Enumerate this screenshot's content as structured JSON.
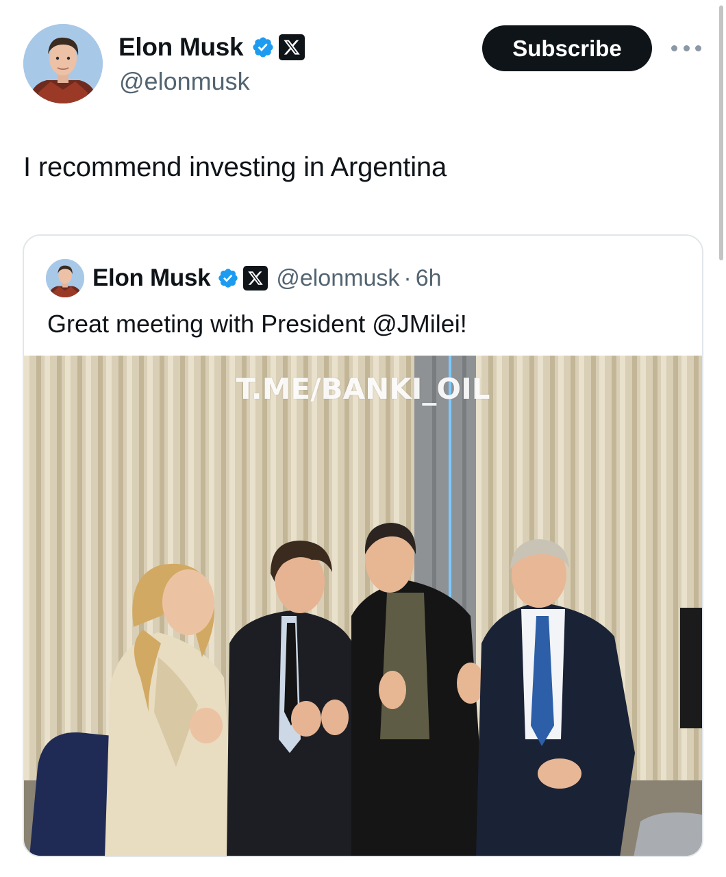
{
  "author": {
    "display_name": "Elon Musk",
    "handle": "@elonmusk",
    "avatar_icon": "profile-avatar",
    "verified_icon": "verified-badge-icon",
    "affiliate_icon": "x-logo-icon"
  },
  "header": {
    "subscribe_label": "Subscribe",
    "more_icon": "more-options-icon"
  },
  "tweet": {
    "text": "I recommend investing in Argentina"
  },
  "quoted_tweet": {
    "display_name": "Elon Musk",
    "handle": "@elonmusk",
    "separator": "·",
    "time": "6h",
    "text": "Great meeting with President @JMilei!",
    "photo": {
      "watermark": "T.ME/BANKI_OIL"
    }
  },
  "colors": {
    "verified_blue": "#1d9bf0",
    "text_primary": "#0f1419",
    "text_secondary": "#536471",
    "button_bg": "#0f1419"
  }
}
